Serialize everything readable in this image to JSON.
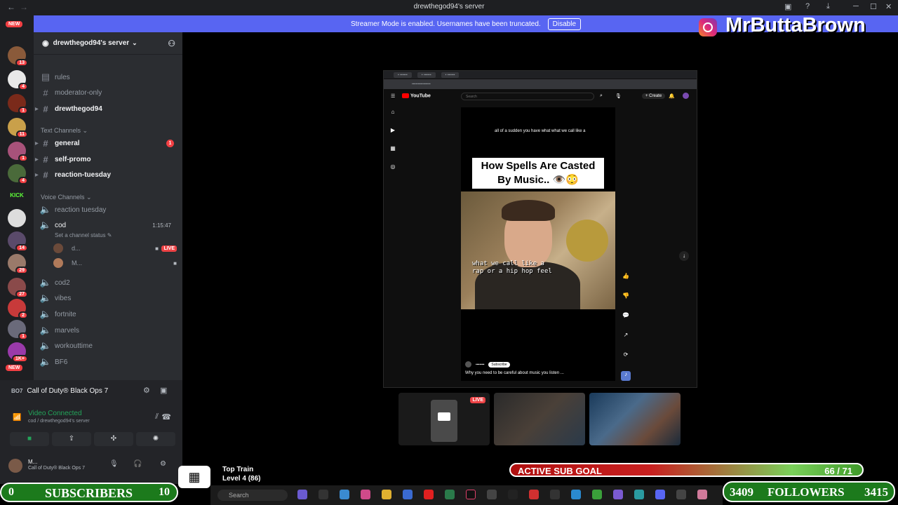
{
  "window": {
    "title": "drewthegod94's server"
  },
  "banner": {
    "text": "Streamer Mode is enabled. Usernames have been truncated.",
    "button": "Disable"
  },
  "rail": {
    "new_top": "NEW",
    "new_bottom": "NEW",
    "badges": [
      "13",
      "4",
      "1",
      "11",
      "1",
      "4",
      "14",
      "29",
      "27",
      "2",
      "1",
      "1K+"
    ]
  },
  "server": {
    "name": "drewthegod94's server"
  },
  "channels": {
    "top": [
      {
        "label": "rules"
      },
      {
        "label": "moderator-only"
      },
      {
        "label": "drewthegod94"
      }
    ],
    "text_category": "Text Channels",
    "text": [
      {
        "label": "general",
        "unread": "1"
      },
      {
        "label": "self-promo"
      },
      {
        "label": "reaction-tuesday"
      }
    ],
    "voice_category": "Voice Channels",
    "voice": [
      {
        "label": "reaction tuesday"
      },
      {
        "label": "cod",
        "timer": "1:15:47",
        "status": "Set a channel status"
      },
      {
        "label": "cod2"
      },
      {
        "label": "vibes"
      },
      {
        "label": "fortnite"
      },
      {
        "label": "marvels"
      },
      {
        "label": "workouttime"
      },
      {
        "label": "BF6"
      }
    ],
    "voice_users": [
      {
        "name": "d...",
        "live": "LIVE"
      },
      {
        "name": "M..."
      }
    ]
  },
  "panel": {
    "game": "Call of Duty® Black Ops 7",
    "vc_status": "Video Connected",
    "vc_path": "cod / drewthegod94's server",
    "user_name": "M...",
    "user_status": "Call of Duty® Black Ops 7"
  },
  "stream": {
    "yt_brand": "YouTube",
    "search": "Search",
    "create": "+ Create",
    "caption_top": "all of a sudden you have what what we call like a",
    "title_card": "How Spells Are Casted By Music.. 👁️😳",
    "subtitle": "what we call like a rap or a hip hop feel",
    "subscribe": "Subscribe",
    "description": "Why you need to be careful about music you listen ..."
  },
  "tiles": {
    "live": "LIVE"
  },
  "overlay": {
    "handle": "MrButtaBrown",
    "sub_goal_label": "ACTIVE SUB GOAL",
    "sub_goal_count": "66 / 71",
    "sub_goal_current": 66,
    "sub_goal_target": 71,
    "subs_left": "0",
    "subs_label": "SUBSCRIBERS",
    "subs_right": "10",
    "foll_left": "3409",
    "foll_label": "FOLLOWERS",
    "foll_right": "3415",
    "train_title": "Top Train",
    "train_level": "Level 4 (86)",
    "taskbar_search": "Search"
  },
  "colors": {
    "blurple": "#5865f2",
    "green": "#23a55a",
    "red": "#ed4245"
  }
}
